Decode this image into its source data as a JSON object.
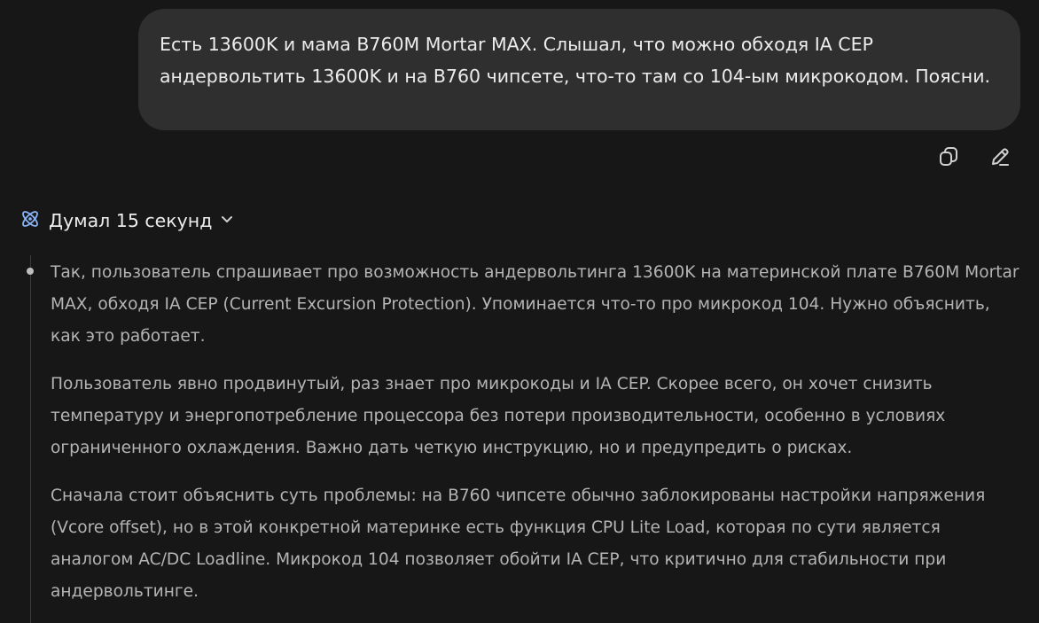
{
  "user_message": {
    "text": "Есть 13600K и мама B760M Mortar MAX. Слышал, что можно обходя IA CEP андервольтить 13600K и на B760 чипсете, что-то там со 104-ым микрокодом. Поясни."
  },
  "message_actions": [
    {
      "icon": "copy-icon"
    },
    {
      "icon": "edit-pencil-icon"
    }
  ],
  "thought": {
    "icon": "atom-icon",
    "label": "Думал 15 секунд",
    "expand_icon": "chevron-down-icon",
    "paragraphs": [
      "Так, пользователь спрашивает про возможность андервольтинга 13600K на материнской плате B760M Mortar MAX, обходя IA CEP (Current Excursion Protection). Упоминается что-то про микрокод 104. Нужно объяснить, как это работает.",
      "Пользователь явно продвинутый, раз знает про микрокоды и IA CEP. Скорее всего, он хочет снизить температуру и энергопотребление процессора без потери производительности, особенно в условиях ограниченного охлаждения. Важно дать четкую инструкцию, но и предупредить о рисках.",
      "Сначала стоит объяснить суть проблемы: на B760 чипсете обычно заблокированы настройки напряжения (Vcore offset), но в этой конкретной материнке есть функция CPU Lite Load, которая по сути является аналогом AC/DC Loadline. Микрокод 104 позволяет обойти IA CEP, что критично для стабильности при андервольтинге."
    ]
  },
  "colors": {
    "background": "#171717",
    "user_bubble": "#2f2f2f",
    "text_primary": "#ececec",
    "text_secondary": "#b4b4b4",
    "accent_icon": "#8ab4f8"
  }
}
